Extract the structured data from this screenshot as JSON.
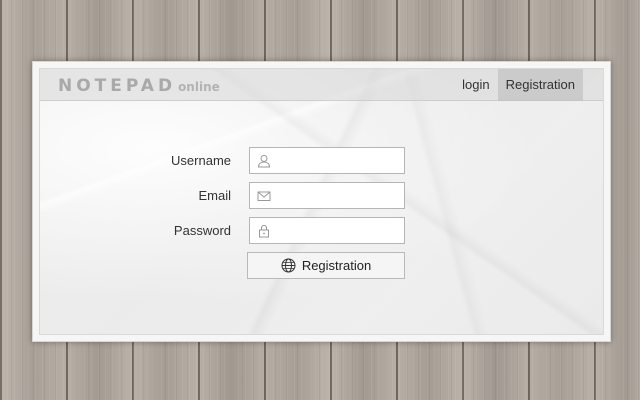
{
  "header": {
    "logo_main": "NOTEPAD",
    "logo_sub": "online",
    "nav": {
      "login_label": "login",
      "registration_label": "Registration"
    }
  },
  "form": {
    "username": {
      "label": "Username",
      "value": "",
      "icon": "user-icon"
    },
    "email": {
      "label": "Email",
      "value": "",
      "icon": "envelope-icon"
    },
    "password": {
      "label": "Password",
      "value": "",
      "icon": "lock-icon"
    },
    "submit": {
      "label": "Registration",
      "icon": "globe-icon"
    }
  },
  "colors": {
    "panel": "#f6f6f5",
    "header": "#d7d7d7",
    "logo": "#a9a9a9",
    "text": "#333333",
    "field_border": "#b5b5b5"
  }
}
